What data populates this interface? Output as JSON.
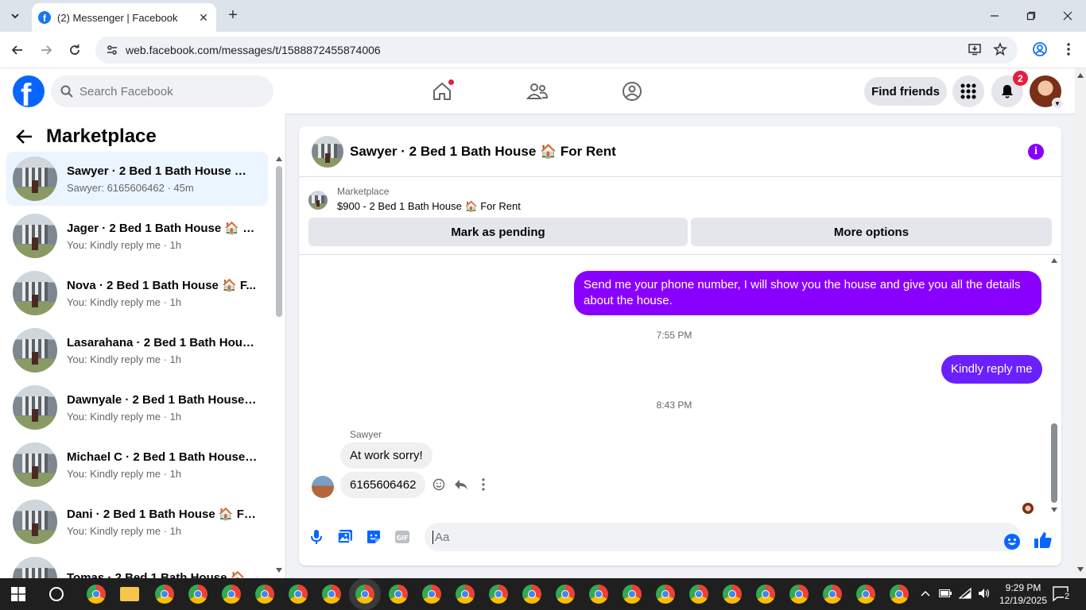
{
  "browser": {
    "tab_title": "(2) Messenger | Facebook",
    "url": "web.facebook.com/messages/t/1588872455874006"
  },
  "fb": {
    "search_placeholder": "Search Facebook",
    "find_friends": "Find friends",
    "notifications_count": "2"
  },
  "sidebar": {
    "title": "Marketplace",
    "conversations": [
      {
        "name": "Sawyer · 2 Bed 1 Bath House 🏠 ...",
        "sub": "Sawyer: 6165606462 · 45m"
      },
      {
        "name": "Jager · 2 Bed 1 Bath House 🏠 F...",
        "sub": "You: Kindly reply me · 1h"
      },
      {
        "name": "Nova · 2 Bed 1 Bath House 🏠 F...",
        "sub": "You: Kindly reply me · 1h"
      },
      {
        "name": "Lasarahana · 2 Bed 1 Bath House...",
        "sub": "You: Kindly reply me · 1h"
      },
      {
        "name": "Dawnyale · 2 Bed 1 Bath House ...",
        "sub": "You: Kindly reply me · 1h"
      },
      {
        "name": "Michael C · 2 Bed 1 Bath House ...",
        "sub": "You: Kindly reply me · 1h"
      },
      {
        "name": "Dani · 2 Bed 1 Bath House 🏠 Fo...",
        "sub": "You: Kindly reply me · 1h"
      },
      {
        "name": "Tomas · 2 Bed 1 Bath House 🏠 F...",
        "sub": ""
      }
    ]
  },
  "chat": {
    "title": "Sawyer · 2 Bed 1 Bath House 🏠 For Rent",
    "marketplace_label": "Marketplace",
    "listing": "$900 - 2 Bed 1 Bath House 🏠 For Rent",
    "mark_pending": "Mark as pending",
    "more_options": "More options",
    "messages": {
      "out1": "Send me your phone number, I will show you the house and give you all the details about the house.",
      "time1": "7:55 PM",
      "out2": "Kindly reply me",
      "time2": "8:43 PM",
      "sender": "Sawyer",
      "in1": "At work sorry!",
      "in2": "6165606462"
    },
    "composer_placeholder": "Aa"
  },
  "taskbar": {
    "time": "9:29 PM",
    "date": "12/19/2025",
    "notifications": "2"
  },
  "colors": {
    "fb_blue": "#0866ff",
    "messenger_purple": "#8a00ff",
    "badge_red": "#e41e3f"
  }
}
